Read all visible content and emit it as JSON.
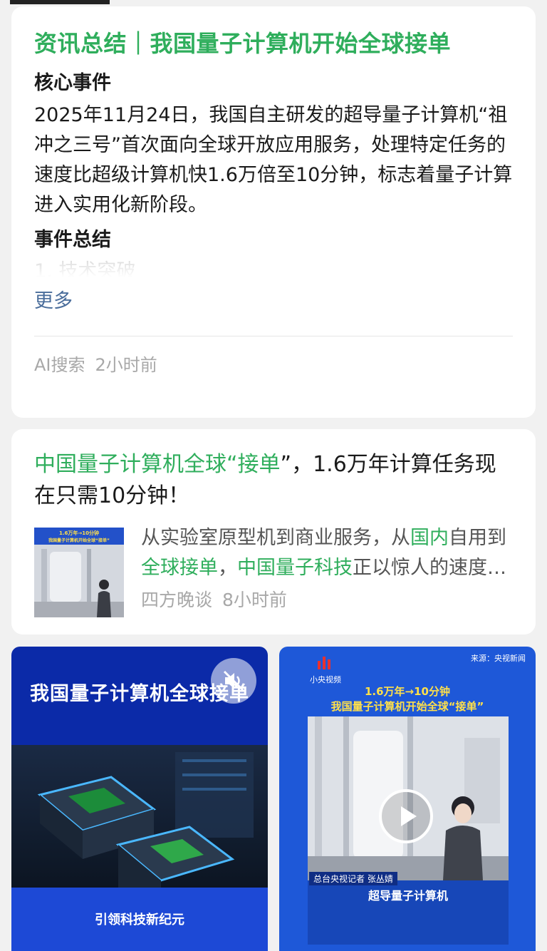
{
  "summary_card": {
    "title": "资讯总结｜我国量子计算机开始全球接单",
    "core_heading": "核心事件",
    "core_text": "2025年11月24日，我国自主研发的超导量子计算机“祖冲之三号”首次面向全球开放应用服务，处理特定任务的速度比超级计算机快1.6万倍至10分钟，标志着量子计算进入实用化新阶段。",
    "summary_heading": "事件总结",
    "faded_text": "1. 技术突破",
    "more_label": "更多",
    "source": "AI搜索",
    "time": "2小时前"
  },
  "article_card": {
    "title_part1": "中国量子计算机全球“",
    "title_part2": "接单",
    "title_part3": "”，1.6万年计算任务现在只需10分钟！",
    "thumb_caption_1": "1.6万年→10分钟",
    "thumb_caption_2": "我国量子计算机开始全球“接单”",
    "snippet_1": "从实验室原型机到商业服务，从",
    "snippet_2": "国内",
    "snippet_3": "自用到",
    "snippet_4": "全球接单",
    "snippet_5": "，",
    "snippet_6": "中国量子科技",
    "snippet_7": "正以惊人的速度发展…",
    "source": "四方晚谈",
    "time": "8小时前"
  },
  "video_tiles": [
    {
      "title": "我国量子计算机全球接单",
      "footer": "引领科技新纪元",
      "icon": "mute-icon"
    },
    {
      "source_label": "来源：央视新闻",
      "logo_text": "小央视频",
      "headline_1": "1.6万年→10分钟",
      "headline_2": "我国量子计算机开始全球“接单”",
      "reporter": "总台央视记者 张丛婧",
      "caption": "超导量子计算机",
      "icon": "play-icon"
    }
  ],
  "colors": {
    "accent_green": "#2fae5c",
    "link_blue": "#4a6d9b",
    "meta_gray": "#a8a8a8",
    "tile_blue_dark": "#0b2aa8",
    "tile_blue": "#1e58d8"
  }
}
